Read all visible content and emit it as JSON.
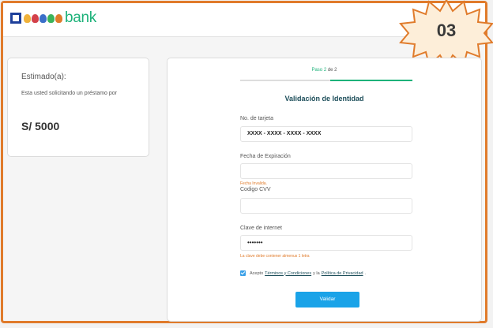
{
  "header": {
    "logo_text": "bank",
    "badge_number": "03",
    "colors": {
      "brand_green": "#1db27a",
      "brand_blue": "#1d3f9a",
      "frame_orange": "#e07b2b",
      "badge_fill": "#fdeed9"
    }
  },
  "summary": {
    "greeting": "Estimado(a):",
    "request_text": "Esta usted solicitando un préstamo por",
    "amount": "S/ 5000"
  },
  "form": {
    "step_prefix": "Paso",
    "step_current": "2",
    "step_rest": "de 2",
    "title": "Validación de Identidad",
    "card_label": "No. de tarjeta",
    "card_value": "XXXX - XXXX - XXXX - XXXX",
    "expiry_label": "Fecha de Expiración",
    "expiry_value": "",
    "expiry_error": "Fecha Invalida.",
    "cvv_label": "Codigo CVV",
    "cvv_value": "",
    "password_label": "Clave de internet",
    "password_value": "•••••••",
    "password_error": "La clave debe contener almenus 1 letra",
    "terms_accept": "Acepto",
    "terms_link": "Términos y Condiciones",
    "terms_and": "y la",
    "privacy_link": "Política de Privacidad",
    "terms_end": ".",
    "submit_label": "Validar",
    "colors": {
      "accent_blue": "#1aa3e8",
      "error_orange": "#e07b2b",
      "title_color": "#1d4e5a"
    }
  }
}
